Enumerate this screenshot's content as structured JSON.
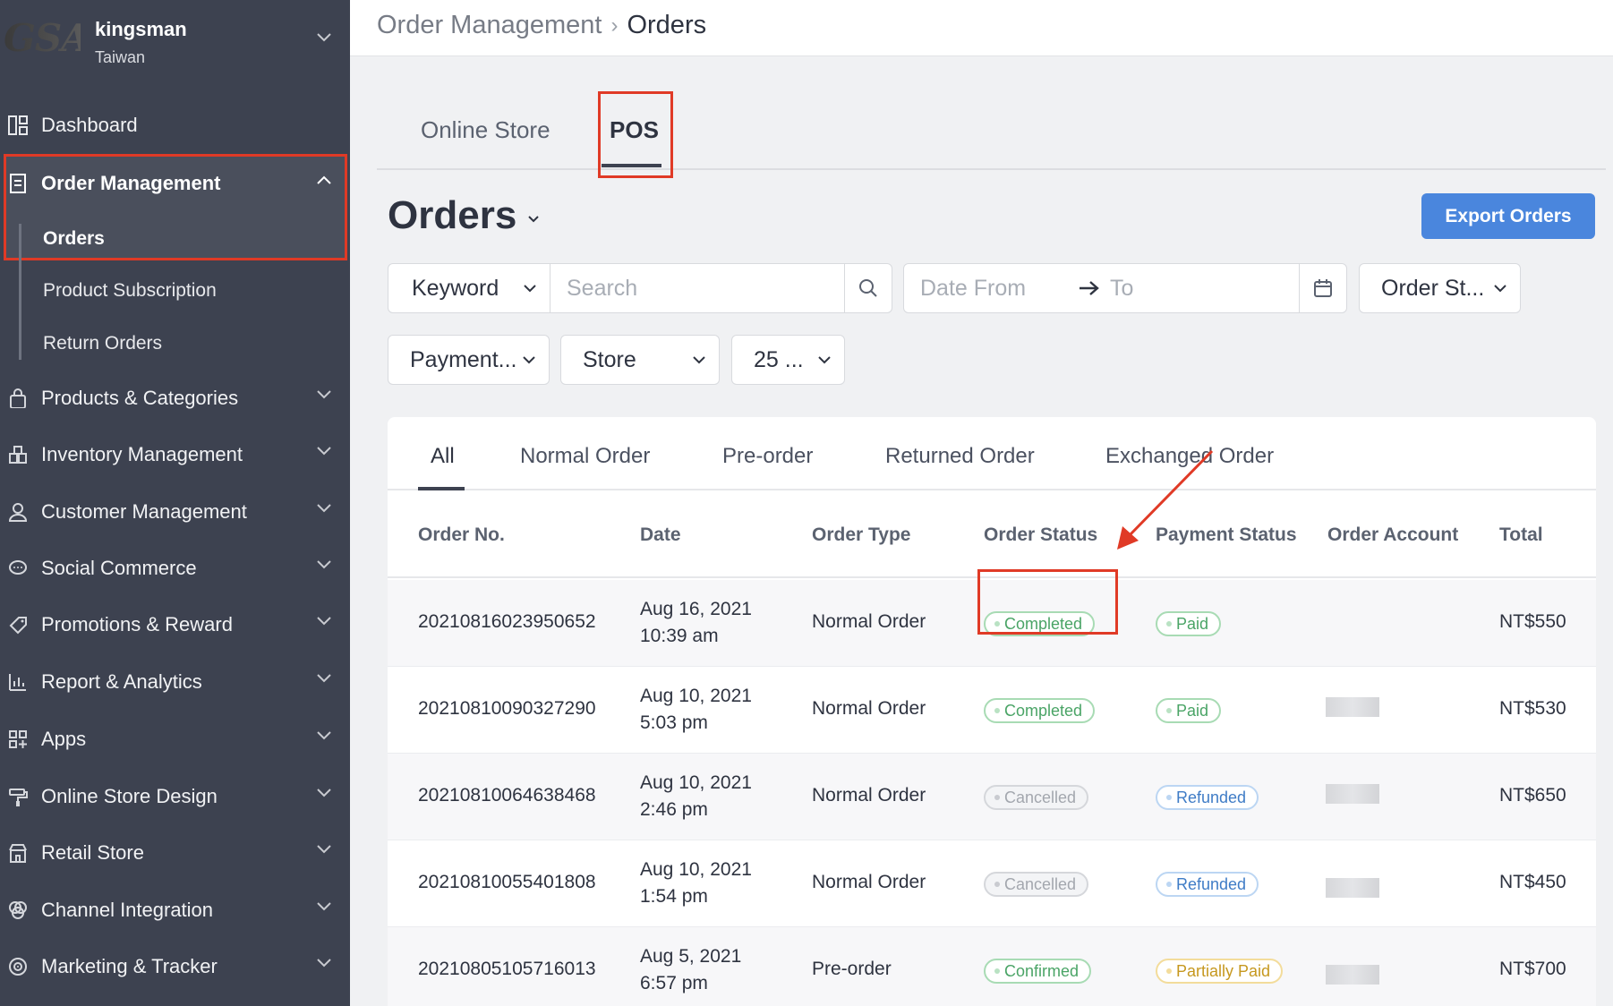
{
  "account": {
    "logo_text": "GSA",
    "name": "kingsman",
    "region": "Taiwan"
  },
  "sidebar": {
    "dashboard": "Dashboard",
    "order_management": "Order Management",
    "order_sub": [
      "Orders",
      "Product Subscription",
      "Return Orders"
    ],
    "items": [
      "Products & Categories",
      "Inventory Management",
      "Customer Management",
      "Social Commerce",
      "Promotions & Reward",
      "Report & Analytics",
      "Apps",
      "Online Store Design",
      "Retail Store",
      "Channel Integration",
      "Marketing & Tracker"
    ]
  },
  "breadcrumb": {
    "parent": "Order Management",
    "current": "Orders"
  },
  "top_tabs": [
    "Online Store",
    "POS"
  ],
  "page_title": "Orders",
  "export_label": "Export Orders",
  "filters": {
    "keyword": "Keyword",
    "search_placeholder": "Search",
    "date_from": "Date From",
    "date_to": "To",
    "order_status": "Order St...",
    "payment": "Payment...",
    "store": "Store",
    "per_page": "25 ..."
  },
  "order_tabs": [
    "All",
    "Normal Order",
    "Pre-order",
    "Returned Order",
    "Exchanged Order"
  ],
  "columns": [
    "Order No.",
    "Date",
    "Order Type",
    "Order Status",
    "Payment Status",
    "Order Account",
    "Total"
  ],
  "rows": [
    {
      "no": "20210816023950652",
      "date": "Aug 16, 2021",
      "time": "10:39 am",
      "type": "Normal Order",
      "status": "Completed",
      "payment": "Paid",
      "total": "NT$550"
    },
    {
      "no": "20210810090327290",
      "date": "Aug 10, 2021",
      "time": "5:03 pm",
      "type": "Normal Order",
      "status": "Completed",
      "payment": "Paid",
      "total": "NT$530"
    },
    {
      "no": "20210810064638468",
      "date": "Aug 10, 2021",
      "time": "2:46 pm",
      "type": "Normal Order",
      "status": "Cancelled",
      "payment": "Refunded",
      "total": "NT$650"
    },
    {
      "no": "20210810055401808",
      "date": "Aug 10, 2021",
      "time": "1:54 pm",
      "type": "Normal Order",
      "status": "Cancelled",
      "payment": "Refunded",
      "total": "NT$450"
    },
    {
      "no": "20210805105716013",
      "date": "Aug 5, 2021",
      "time": "6:57 pm",
      "type": "Pre-order",
      "status": "Confirmed",
      "payment": "Partially Paid",
      "total": "NT$700"
    }
  ],
  "colors": {
    "sidebar": "#3d4250",
    "accent": "#4a86dd",
    "highlight": "#e03a26"
  }
}
